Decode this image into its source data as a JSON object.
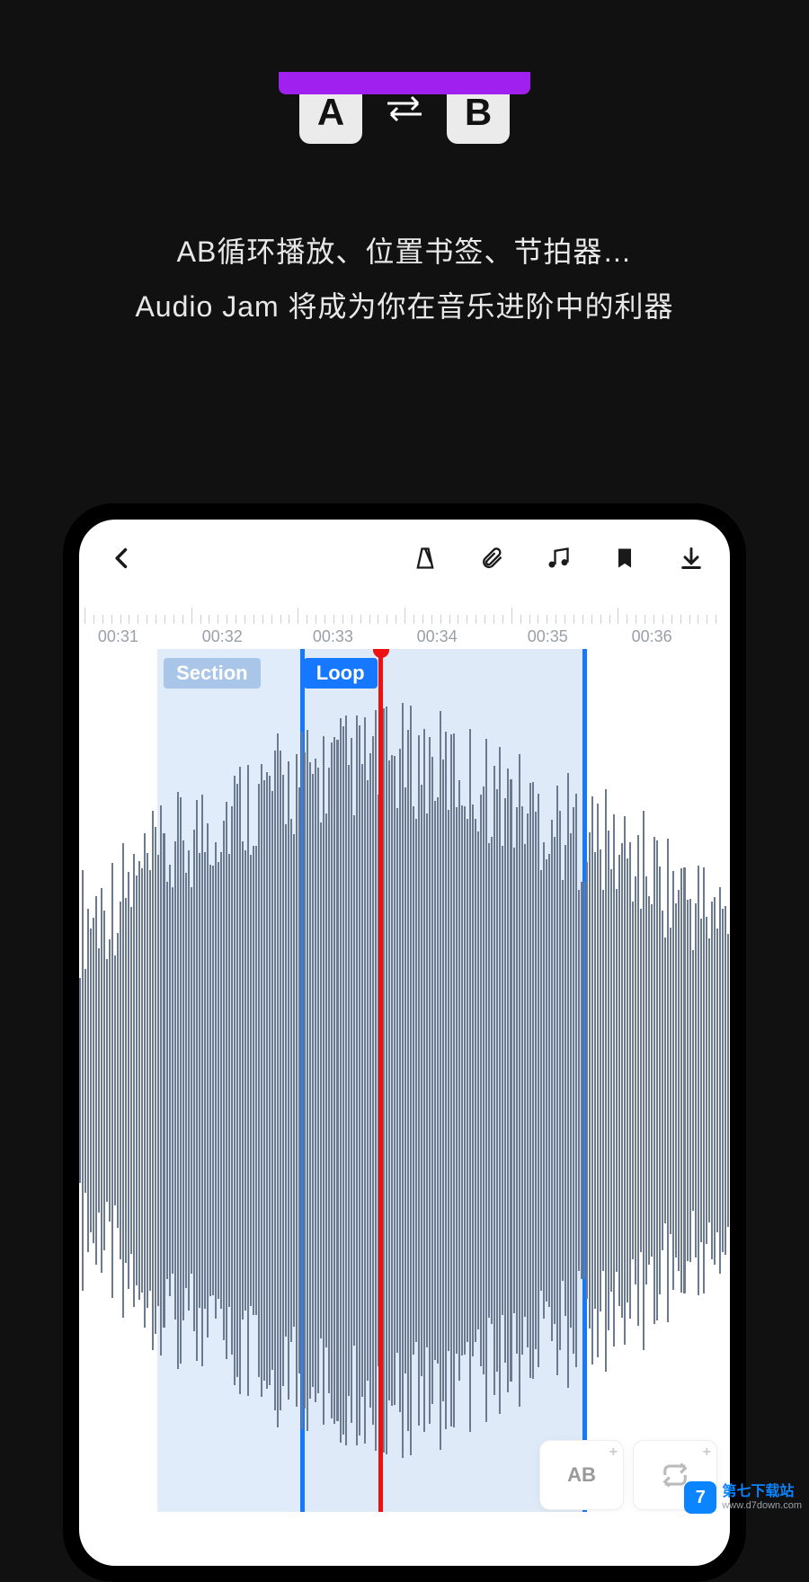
{
  "promo": {
    "tile_a": "A",
    "tile_b": "B",
    "line1": "AB循环播放、位置书签、节拍器…",
    "line2": "Audio Jam 将成为你在音乐进阶中的利器"
  },
  "toolbar": {
    "back": "back",
    "metronome": "metronome",
    "attachment": "attachment",
    "music": "music",
    "bookmark": "bookmark",
    "download": "download"
  },
  "timeline": {
    "labels": [
      "00:31",
      "00:32",
      "00:33",
      "00:34",
      "00:35",
      "00:36"
    ],
    "label_positions_pct": [
      6,
      22,
      39,
      55,
      72,
      88
    ],
    "section_label": "Section",
    "loop_label": "Loop",
    "section_start_pct": 12,
    "section_end_pct": 34,
    "loop_start_pct": 34,
    "loop_end_pct": 78,
    "playhead_pct": 46
  },
  "bottom": {
    "ab_card": "AB"
  },
  "watermark": {
    "badge": "7",
    "title": "第七下载站",
    "url": "www.d7down.com"
  },
  "colors": {
    "accent_purple": "#a020f0",
    "accent_blue": "#1677ff",
    "playhead_red": "#e11",
    "wave_gray": "#6b7a8f"
  }
}
